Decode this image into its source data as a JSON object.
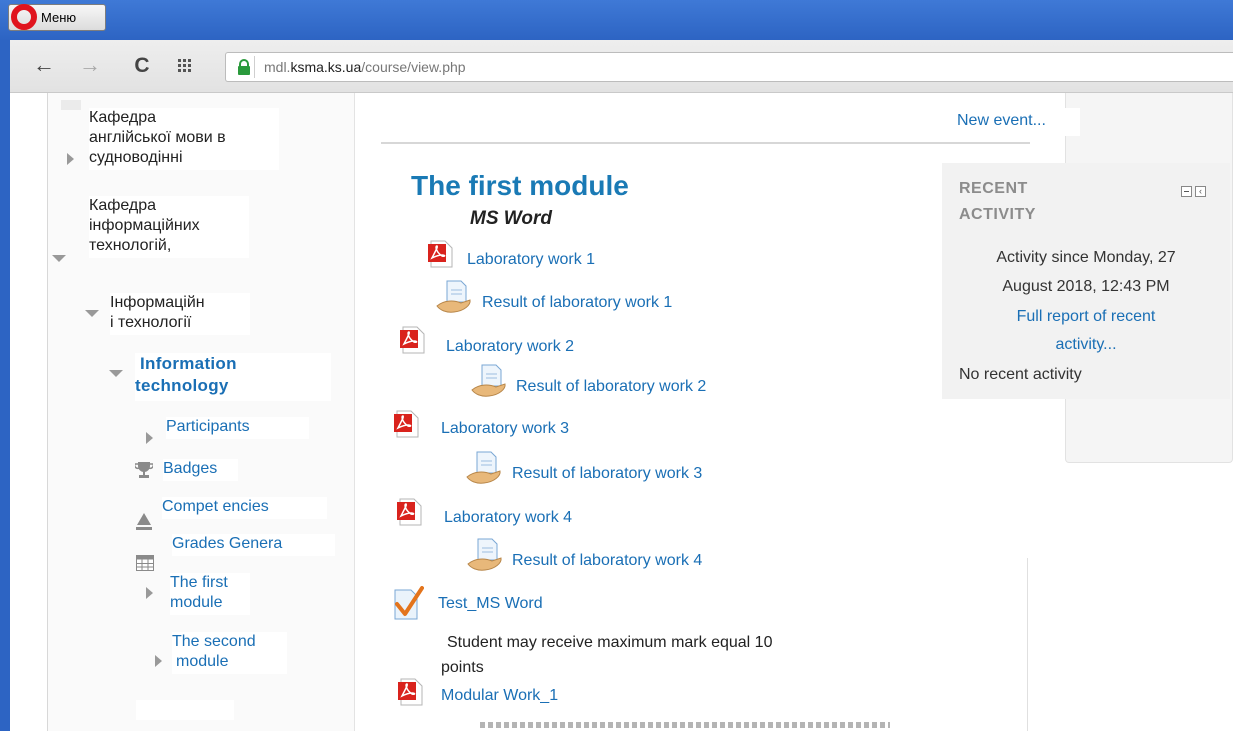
{
  "browser": {
    "menu_label": "Меню",
    "url_prefix": "mdl.",
    "url_host": "ksma.ks.ua",
    "url_path": "/course/view.php"
  },
  "nav": {
    "dept_english": [
      "Кафедра",
      "англійської мови в",
      "судноводінні"
    ],
    "dept_it": [
      "Кафедра",
      "інформаційних",
      "технологій,"
    ],
    "subject": [
      "Інформаційн",
      "і технології"
    ],
    "course": [
      "Information",
      "technology"
    ],
    "participants": "Participants",
    "badges": "Badges",
    "competencies": "Compet encies",
    "grades": "Grades Genera",
    "first_module": [
      "The first",
      "module"
    ],
    "second_module": [
      "The second",
      "module"
    ]
  },
  "main": {
    "new_event": "New event...",
    "module_title": "The first module",
    "module_subtitle": "MS Word",
    "items": [
      "Laboratory work 1",
      "Result of laboratory work 1",
      "Laboratory work 2",
      "Result of laboratory work 2",
      "Laboratory work 3",
      "Result of laboratory work 3",
      "Laboratory work 4",
      "Result of laboratory work 4",
      "Test_MS Word",
      "Modular Work_1"
    ],
    "test_note": [
      "Student may receive maximum mark equal 10",
      "points"
    ]
  },
  "recent": {
    "title": [
      "RECENT",
      "ACTIVITY"
    ],
    "since": [
      "Activity since Monday, 27",
      "August 2018, 12:43 PM"
    ],
    "full_report": [
      "Full report of recent",
      "activity..."
    ],
    "none": "No recent activity"
  },
  "colors": {
    "link": "#1a6fb5",
    "titlebar": "#2d64c3",
    "module_title": "#1a7ab5"
  }
}
